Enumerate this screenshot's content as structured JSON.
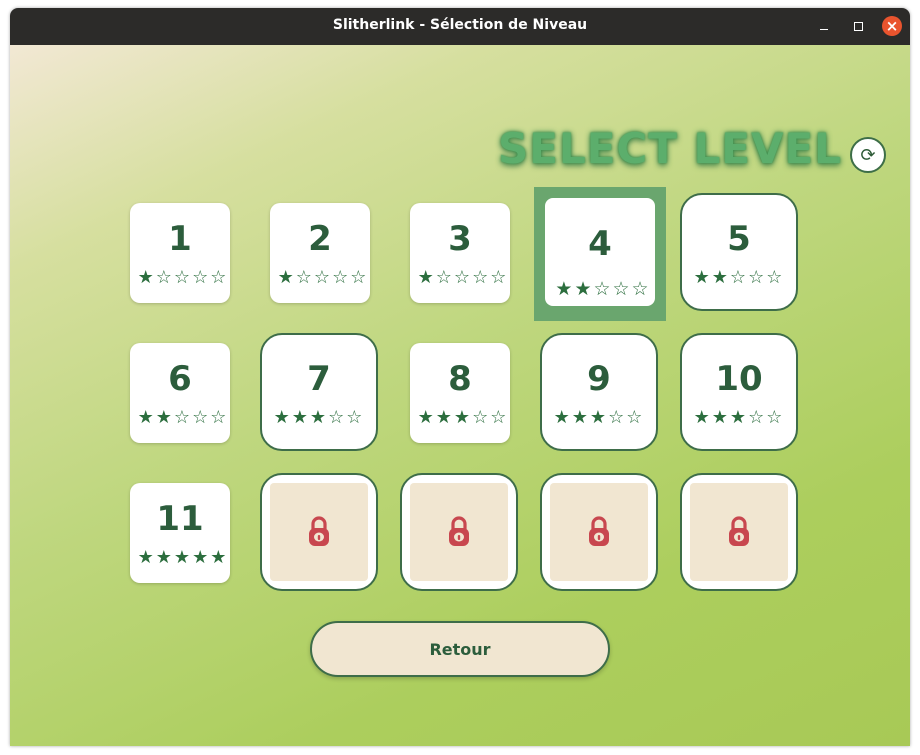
{
  "window": {
    "title": "Slitherlink - Sélection de Niveau",
    "minimize_glyph": "–",
    "maximize_glyph": "□",
    "close_glyph": "×"
  },
  "heading": "SELECT LEVEL",
  "refresh_glyph": "⟳",
  "levels": [
    {
      "number": "1",
      "stars": "★☆☆☆☆",
      "earned": 1,
      "state": "unlocked"
    },
    {
      "number": "2",
      "stars": "★☆☆☆☆",
      "earned": 1,
      "state": "unlocked"
    },
    {
      "number": "3",
      "stars": "★☆☆☆☆",
      "earned": 1,
      "state": "unlocked"
    },
    {
      "number": "4",
      "stars": "★★☆☆☆",
      "earned": 2,
      "state": "selected"
    },
    {
      "number": "5",
      "stars": "★★☆☆☆",
      "earned": 2,
      "state": "unlocked"
    },
    {
      "number": "6",
      "stars": "★★☆☆☆",
      "earned": 2,
      "state": "unlocked"
    },
    {
      "number": "7",
      "stars": "★★★☆☆",
      "earned": 3,
      "state": "unlocked"
    },
    {
      "number": "8",
      "stars": "★★★☆☆",
      "earned": 3,
      "state": "unlocked"
    },
    {
      "number": "9",
      "stars": "★★★☆☆",
      "earned": 3,
      "state": "unlocked"
    },
    {
      "number": "10",
      "stars": "★★★☆☆",
      "earned": 3,
      "state": "unlocked"
    },
    {
      "number": "11",
      "stars": "★★★★★",
      "earned": 5,
      "state": "unlocked"
    },
    {
      "state": "locked"
    },
    {
      "state": "locked"
    },
    {
      "state": "locked"
    },
    {
      "state": "locked"
    }
  ],
  "back_button": "Retour",
  "colors": {
    "accent_green": "#2c5d3c",
    "heading_green": "#5cae6c",
    "lock_red": "#c8474f",
    "locked_fill": "#f1e6d1",
    "close_button": "#e9542e"
  }
}
